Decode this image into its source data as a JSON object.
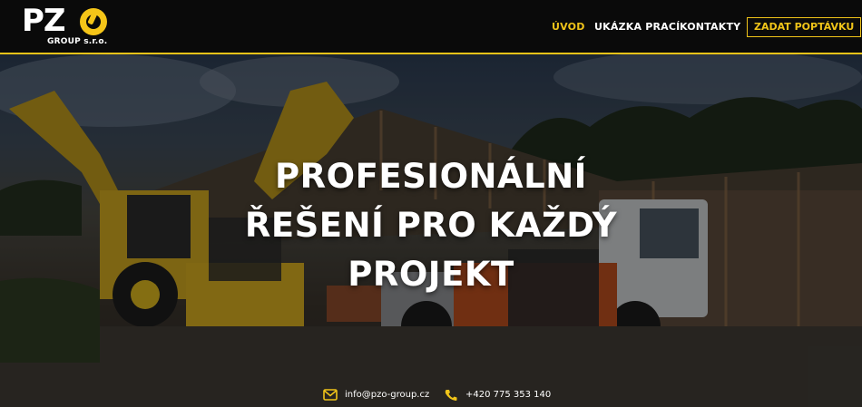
{
  "brand": {
    "logo_text": "PZ",
    "logo_sub": "GROUP s.r.o."
  },
  "nav": {
    "items": [
      {
        "label": "ÚVOD",
        "active": true
      },
      {
        "label": "UKÁZKA PRACÍ",
        "active": false
      },
      {
        "label": "KONTAKTY",
        "active": false
      }
    ],
    "cta_label": "ZADAT POPTÁVKU"
  },
  "hero": {
    "title_lines": [
      "PROFESIONÁLNÍ",
      "ŘEŠENÍ PRO KAŽDÝ",
      "PROJEKT"
    ]
  },
  "contact": {
    "email": "info@pzo-group.cz",
    "phone": "+420 775 353 140"
  },
  "colors": {
    "accent": "#f0c419",
    "header_bg": "#0a0a0a"
  },
  "icons": {
    "email": "mail-icon",
    "phone": "phone-icon"
  }
}
